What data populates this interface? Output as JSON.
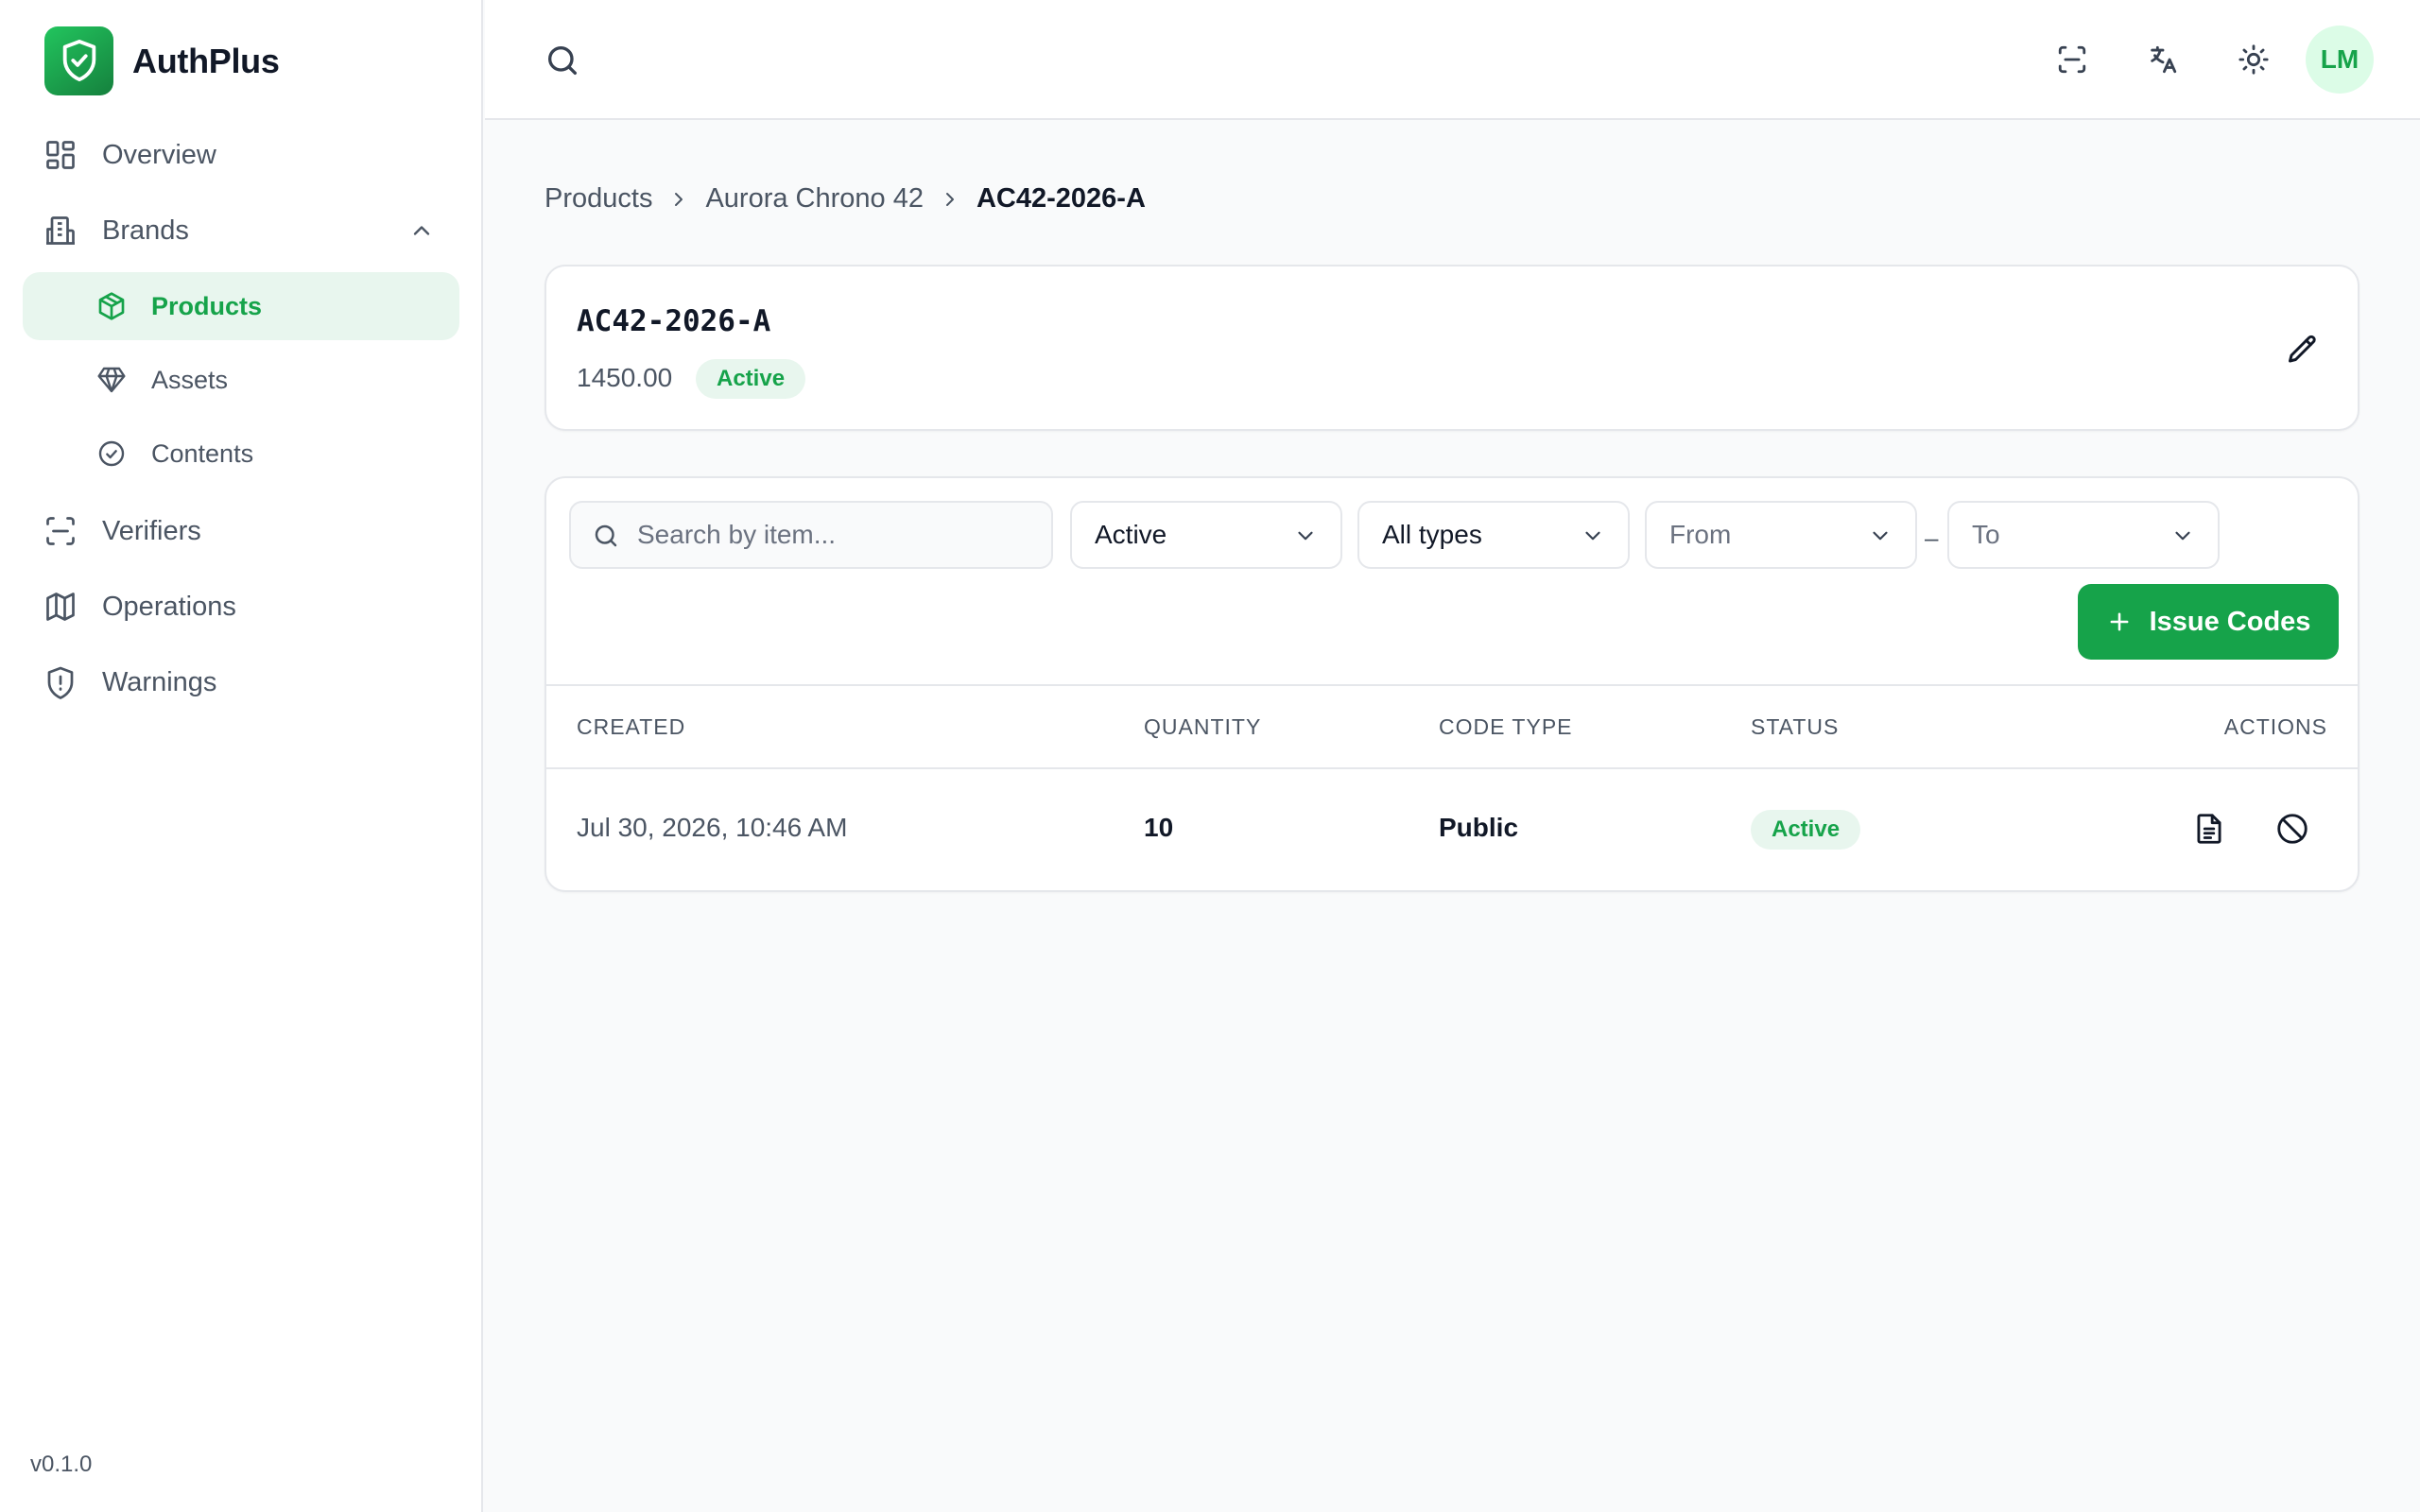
{
  "app": {
    "name": "AuthPlus",
    "version": "v0.1.0"
  },
  "sidebar": {
    "items": [
      {
        "label": "Overview"
      },
      {
        "label": "Brands"
      },
      {
        "label": "Products"
      },
      {
        "label": "Assets"
      },
      {
        "label": "Contents"
      },
      {
        "label": "Verifiers"
      },
      {
        "label": "Operations"
      },
      {
        "label": "Warnings"
      }
    ]
  },
  "header": {
    "avatar_initials": "LM"
  },
  "breadcrumb": [
    "Products",
    "Aurora Chrono 42",
    "AC42-2026-A"
  ],
  "product": {
    "sku": "AC42-2026-A",
    "price": "1450.00",
    "status": "Active"
  },
  "filters": {
    "search_placeholder": "Search by item...",
    "status": "Active",
    "type": "All types",
    "from": "From",
    "separator": "–",
    "to": "To"
  },
  "actions": {
    "issue_codes": "Issue Codes"
  },
  "table": {
    "columns": [
      "CREATED",
      "QUANTITY",
      "CODE TYPE",
      "STATUS",
      "ACTIONS"
    ],
    "rows": [
      {
        "created": "Jul 30, 2026, 10:46 AM",
        "quantity": "10",
        "code_type": "Public",
        "status": "Active"
      }
    ]
  },
  "colors": {
    "accent": "#16a34a",
    "accent_soft": "#e8f6ee",
    "border": "#e5e7eb"
  }
}
